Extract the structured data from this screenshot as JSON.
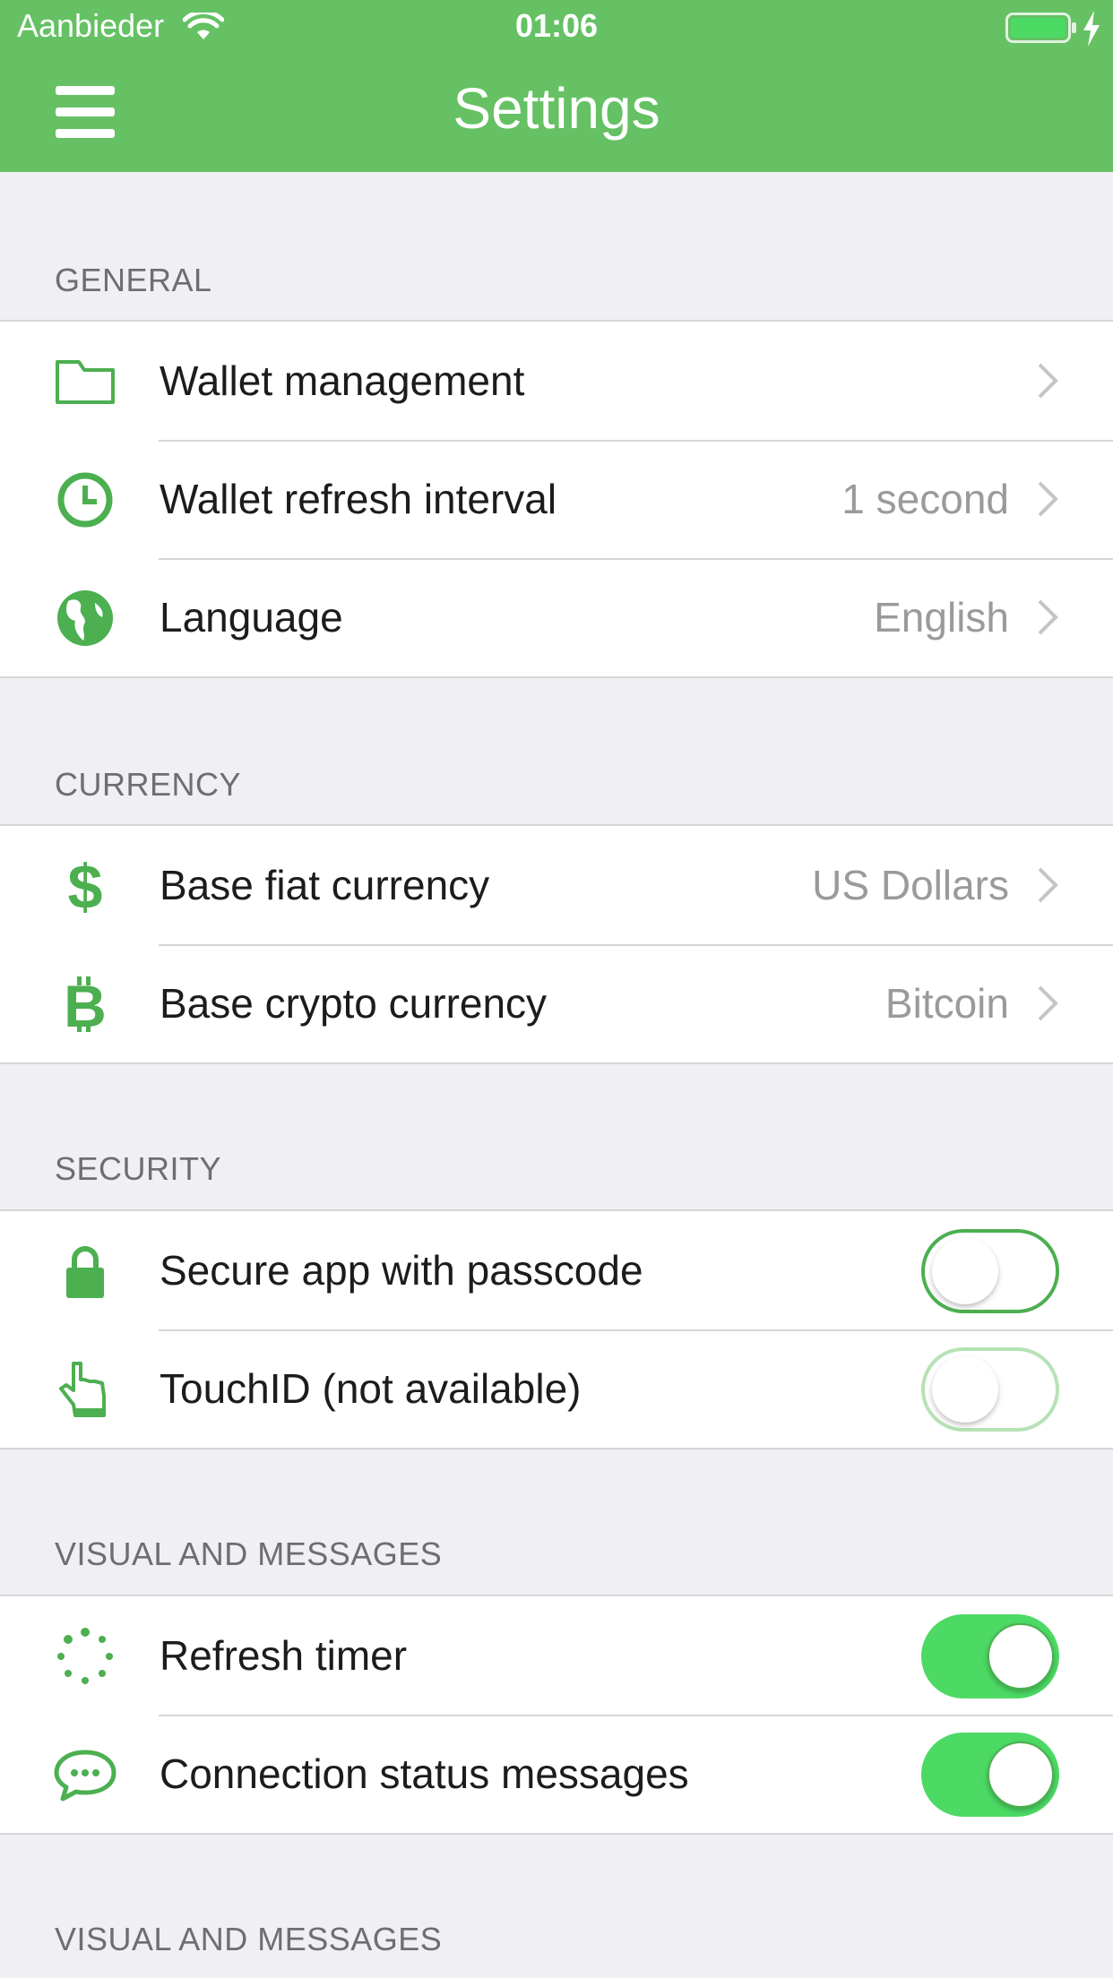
{
  "status_bar": {
    "carrier": "Aanbieder",
    "time": "01:06"
  },
  "header": {
    "title": "Settings",
    "menu_icon": "hamburger-menu-icon"
  },
  "colors": {
    "accent": "#65c163",
    "icon_green": "#4caf50",
    "toggle_on": "#4cd964",
    "background": "#efeff4"
  },
  "sections": {
    "general": {
      "header": "GENERAL",
      "rows": [
        {
          "label": "Wallet management",
          "value": "",
          "icon": "folder-icon"
        },
        {
          "label": "Wallet refresh interval",
          "value": "1 second",
          "icon": "clock-icon"
        },
        {
          "label": "Language",
          "value": "English",
          "icon": "globe-icon"
        }
      ]
    },
    "currency": {
      "header": "CURRENCY",
      "rows": [
        {
          "label": "Base fiat currency",
          "value": "US Dollars",
          "icon": "dollar-icon"
        },
        {
          "label": "Base crypto currency",
          "value": "Bitcoin",
          "icon": "bitcoin-icon"
        }
      ]
    },
    "security": {
      "header": "SECURITY",
      "rows": [
        {
          "label": "Secure app with passcode",
          "icon": "lock-icon",
          "toggle": false,
          "enabled": true
        },
        {
          "label": "TouchID (not available)",
          "icon": "finger-pointer-icon",
          "toggle": false,
          "enabled": false
        }
      ]
    },
    "visual": {
      "header": "VISUAL AND MESSAGES",
      "rows": [
        {
          "label": "Refresh timer",
          "icon": "spinner-icon",
          "toggle": true,
          "enabled": true
        },
        {
          "label": "Connection status messages",
          "icon": "speech-bubble-icon",
          "toggle": true,
          "enabled": true
        }
      ]
    },
    "visual_2": {
      "header": "VISUAL AND MESSAGES"
    }
  }
}
